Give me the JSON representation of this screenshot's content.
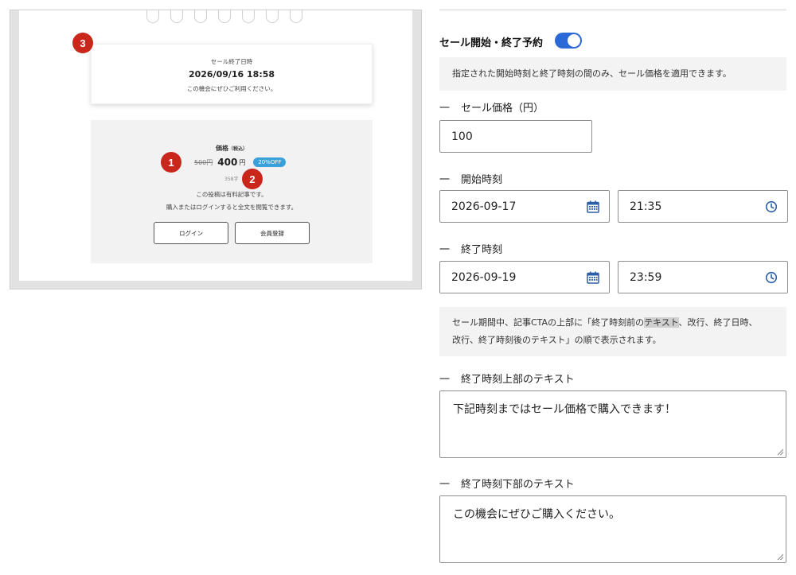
{
  "preview": {
    "sale_end_label": "セール終了日時",
    "sale_end_date": "2026/09/16 18:58",
    "sale_end_msg": "この機会にぜひご利用ください。",
    "price_heading": "価格",
    "price_tax": "（税込）",
    "old_price": "500円",
    "new_price": "400",
    "yen": "円",
    "off_badge": "20%OFF",
    "char_count": "358字",
    "paid_note": "この投稿は有料記事です。",
    "login_note": "購入またはログインすると全文を閲覧できます。",
    "login_button": "ログイン",
    "register_button": "会員登録",
    "markers": [
      "1",
      "2",
      "3"
    ]
  },
  "form": {
    "sale_toggle_label": "セール開始・終了予約",
    "sale_toggle_on": true,
    "note_1": "指定された開始時刻と終了時刻の間のみ、セール価格を適用できます。",
    "dash": "一",
    "price_label": "セール価格（円）",
    "price_value": "100",
    "start_label": "開始時刻",
    "start_date": "2026-09-17",
    "start_time": "21:35",
    "end_label": "終了時刻",
    "end_date": "2026-09-19",
    "end_time": "23:59",
    "note_2_a": "セール期間中、記事CTAの上部に「終了時刻前の",
    "note_2_mark": "テキスト",
    "note_2_b": "、改行、終了日時、",
    "note_2_c": "改行、終了時刻後のテキスト」の順で表示されます。",
    "upper_label": "終了時刻上部のテキスト",
    "upper_text": "下記時刻まではセール価格で購入できます！",
    "lower_label": "終了時刻下部のテキスト",
    "lower_text": "この機会にぜひご購入ください。"
  },
  "colors": {
    "accent": "#2b6ad6",
    "marker": "#c9261c",
    "badge": "#3aa0dc"
  },
  "icons": [
    "calendar-icon",
    "clock-icon",
    "resize-grip-icon"
  ]
}
